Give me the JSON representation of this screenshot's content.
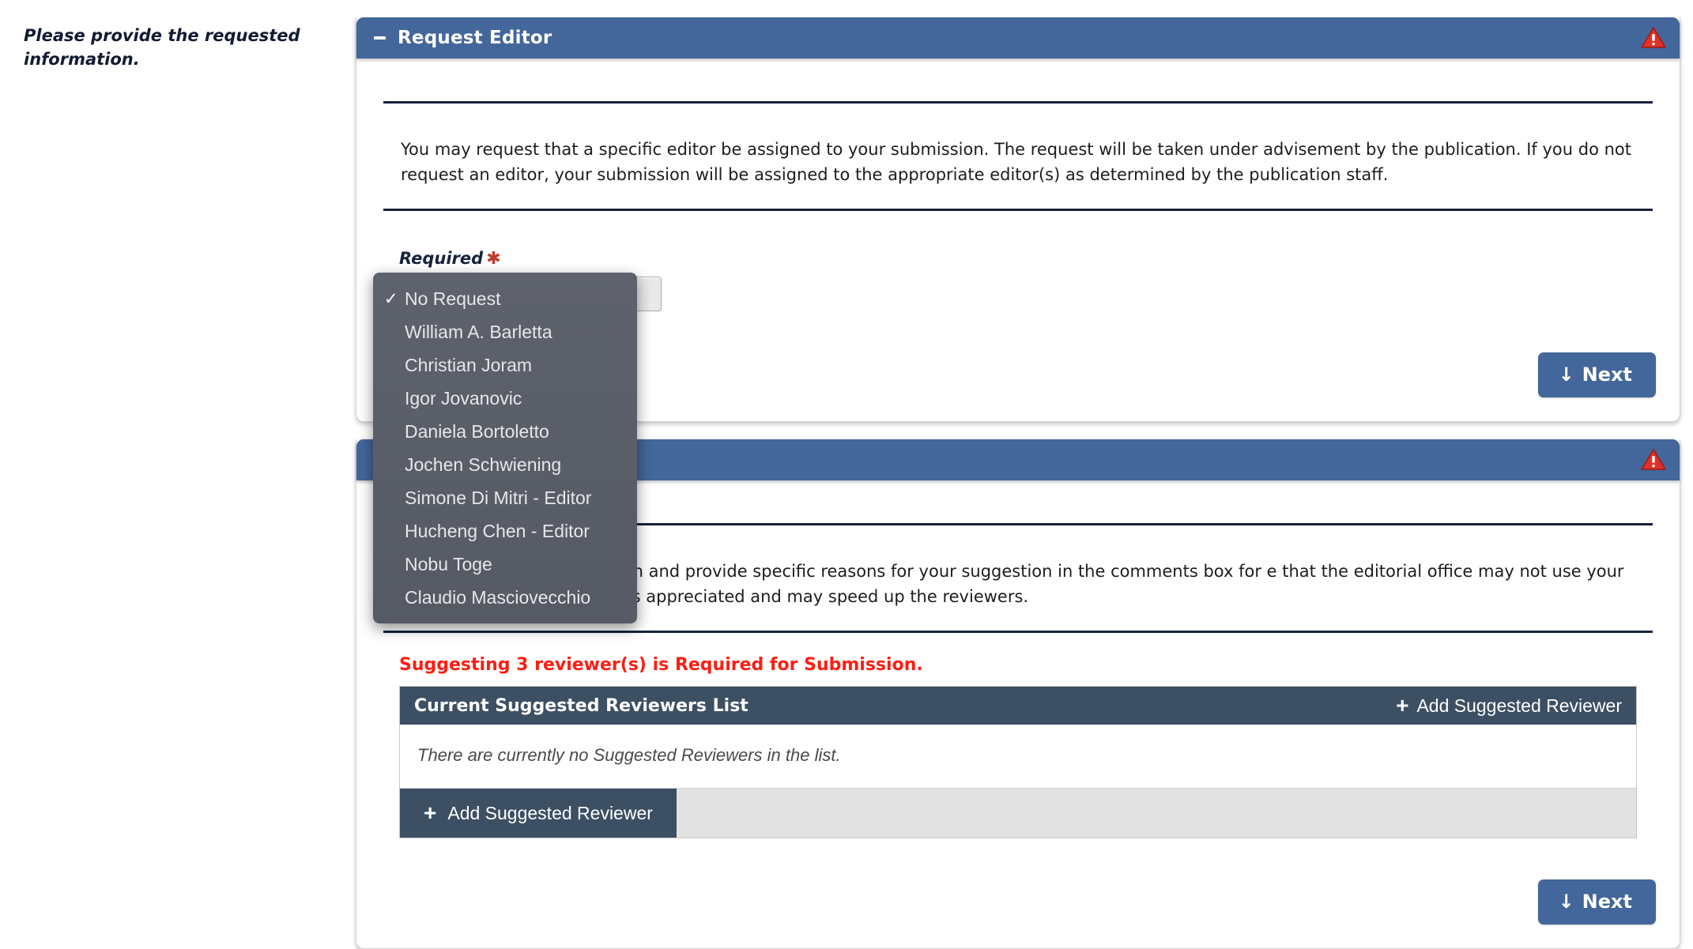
{
  "instruction": "Please provide the requested information.",
  "panels": [
    {
      "title": "Request Editor",
      "collapse_icon": "minus-icon",
      "warning_icon": "warning-triangle-icon",
      "info_text": "You may request that a specific editor be assigned to your submission. The request will be taken under advisement by the publication. If you do not request an editor, your submission will be assigned to the appropriate editor(s) as determined by the publication staff.",
      "field_label": "Required",
      "required_marker": "✱",
      "next_label": "Next",
      "next_icon": "arrow-down-icon"
    },
    {
      "title": "",
      "collapse_icon": "minus-icon",
      "warning_icon": "warning-triangle-icon",
      "info_text": "reviewers for this submission and provide specific reasons for your suggestion in the comments box for e that the editorial office may not use your suggestions, but your help is appreciated and may speed up the reviewers.",
      "required_note": "Suggesting 3 reviewer(s) is Required for Submission.",
      "list": {
        "header_title": "Current Suggested Reviewers List",
        "header_action": "Add Suggested Reviewer",
        "header_action_icon": "plus-icon",
        "empty_message": "There are currently no Suggested Reviewers in the list.",
        "footer_action": "Add Suggested Reviewer",
        "footer_action_icon": "plus-icon"
      },
      "next_label": "Next",
      "next_icon": "arrow-down-icon"
    }
  ],
  "dropdown": {
    "selected": "No Request",
    "check_glyph": "✓",
    "options": [
      "No Request",
      "William A. Barletta",
      "Christian Joram",
      "Igor Jovanovic",
      "Daniela Bortoletto",
      "Jochen Schwiening",
      "Simone Di Mitri - Editor",
      "Hucheng Chen - Editor",
      "Nobu Toge",
      "Claudio Masciovecchio"
    ]
  },
  "colors": {
    "header_blue": "#43669b",
    "list_header": "#3c4f63",
    "alert_red": "#ff1d12",
    "warning_icon": "#e03028",
    "rule_navy": "#16233d"
  }
}
